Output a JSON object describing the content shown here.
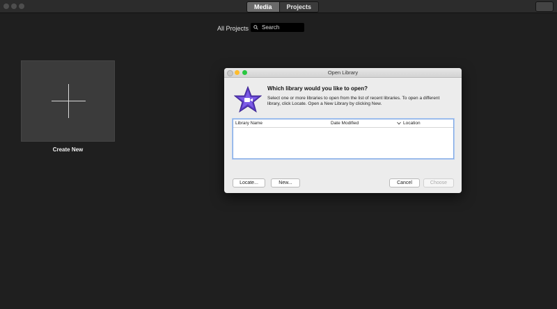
{
  "topbar": {
    "tabs": [
      {
        "label": "Media",
        "active": true
      },
      {
        "label": "Projects",
        "active": false
      }
    ]
  },
  "browser": {
    "scope_label": "All Projects",
    "search_placeholder": "Search"
  },
  "create_new": {
    "label": "Create New"
  },
  "dialog": {
    "title": "Open Library",
    "question": "Which library would you like to open?",
    "description": "Select one or more libraries to open from the list of recent libraries.  To open a different library, click Locate. Open a New Library by clicking New.",
    "columns": [
      "Library Name",
      "Date Modified",
      "Location"
    ],
    "buttons": {
      "locate": "Locate...",
      "new": "New...",
      "cancel": "Cancel",
      "choose": "Choose"
    }
  },
  "colors": {
    "accent_purple": "#5a3bc2",
    "close": "#fc5f57",
    "minimize": "#fdbc2e",
    "zoom": "#28c840"
  }
}
